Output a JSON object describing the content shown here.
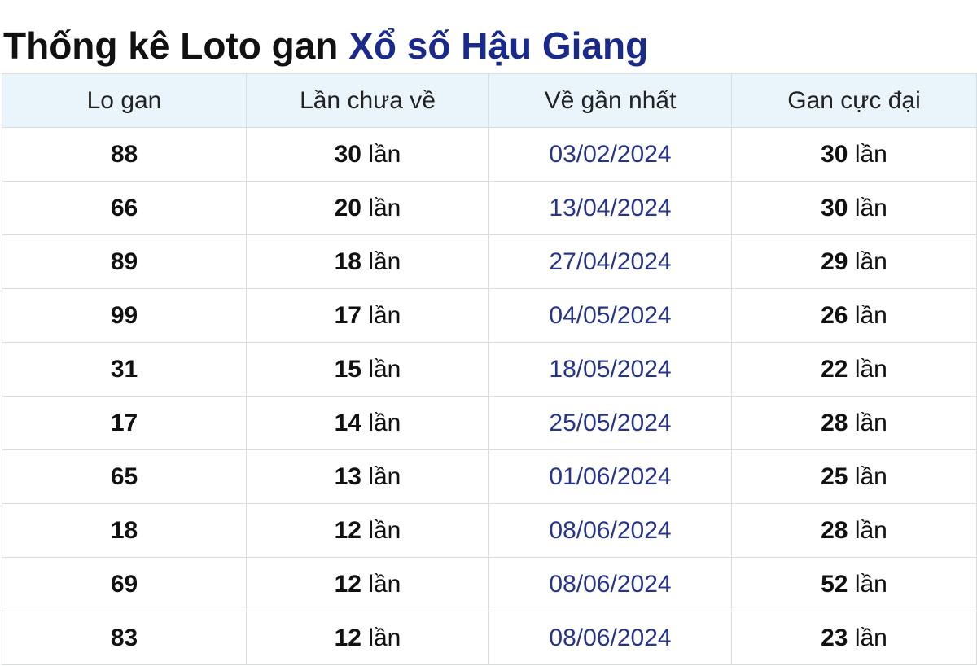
{
  "title": {
    "prefix": "Thống kê Loto gan",
    "link": "Xổ số Hậu Giang"
  },
  "table": {
    "headers": [
      "Lo gan",
      "Lần chưa về",
      "Về gần nhất",
      "Gan cực đại"
    ],
    "unit": "lần",
    "rows": [
      {
        "lo": "88",
        "missed": "30",
        "last_date": "03/02/2024",
        "max_gan": "30"
      },
      {
        "lo": "66",
        "missed": "20",
        "last_date": "13/04/2024",
        "max_gan": "30"
      },
      {
        "lo": "89",
        "missed": "18",
        "last_date": "27/04/2024",
        "max_gan": "29"
      },
      {
        "lo": "99",
        "missed": "17",
        "last_date": "04/05/2024",
        "max_gan": "26"
      },
      {
        "lo": "31",
        "missed": "15",
        "last_date": "18/05/2024",
        "max_gan": "22"
      },
      {
        "lo": "17",
        "missed": "14",
        "last_date": "25/05/2024",
        "max_gan": "28"
      },
      {
        "lo": "65",
        "missed": "13",
        "last_date": "01/06/2024",
        "max_gan": "25"
      },
      {
        "lo": "18",
        "missed": "12",
        "last_date": "08/06/2024",
        "max_gan": "28"
      },
      {
        "lo": "69",
        "missed": "12",
        "last_date": "08/06/2024",
        "max_gan": "52"
      },
      {
        "lo": "83",
        "missed": "12",
        "last_date": "08/06/2024",
        "max_gan": "23"
      }
    ]
  },
  "colors": {
    "link": "#1a2a8c",
    "date": "#27348b",
    "header_bg": "#eaf4fb",
    "border": "#d9dde3"
  }
}
